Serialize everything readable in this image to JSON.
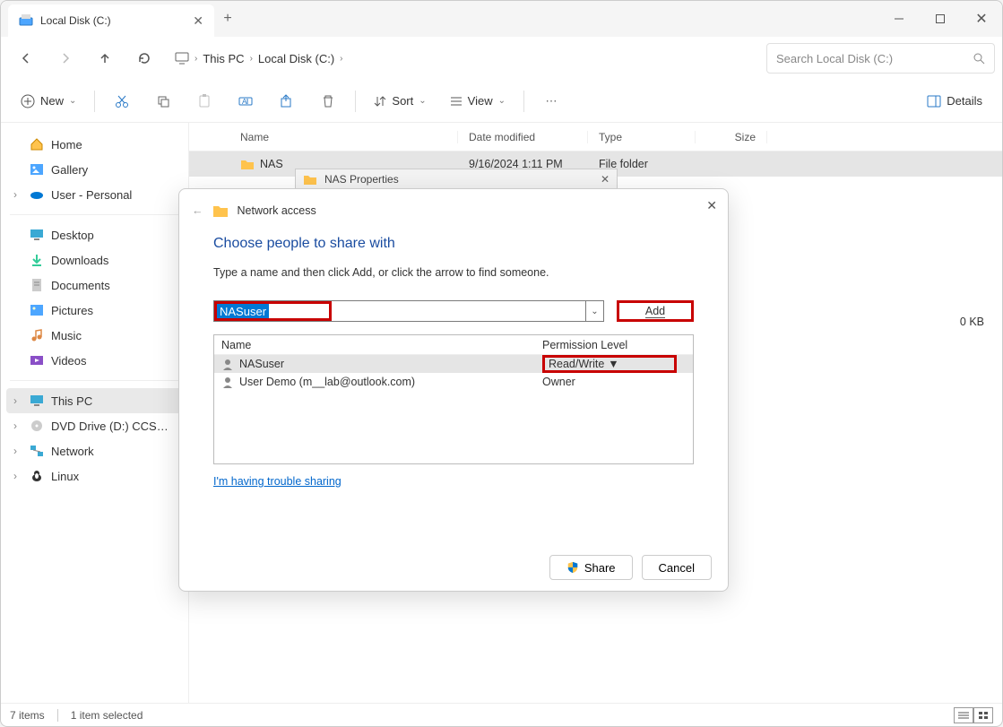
{
  "window": {
    "tab_title": "Local Disk (C:)",
    "breadcrumbs": [
      "This PC",
      "Local Disk (C:)"
    ],
    "search_placeholder": "Search Local Disk (C:)"
  },
  "toolbar": {
    "new": "New",
    "sort": "Sort",
    "view": "View",
    "details": "Details"
  },
  "sidebar": {
    "home": "Home",
    "gallery": "Gallery",
    "user_personal": "User - Personal",
    "desktop": "Desktop",
    "downloads": "Downloads",
    "documents": "Documents",
    "pictures": "Pictures",
    "music": "Music",
    "videos": "Videos",
    "this_pc": "This PC",
    "dvd": "DVD Drive (D:) CCSA_X64FR",
    "network": "Network",
    "linux": "Linux"
  },
  "columns": {
    "name": "Name",
    "date": "Date modified",
    "type": "Type",
    "size": "Size"
  },
  "files": [
    {
      "name": "NAS",
      "date": "9/16/2024 1:11 PM",
      "type": "File folder",
      "size": ""
    }
  ],
  "right_panel_size": "0 KB",
  "props_dialog": {
    "title": "NAS Properties"
  },
  "share_dialog": {
    "header": "Network access",
    "title": "Choose people to share with",
    "instruction": "Type a name and then click Add, or click the arrow to find someone.",
    "input_value": "NASuser",
    "add_button": "Add",
    "col_name": "Name",
    "col_perm": "Permission Level",
    "rows": [
      {
        "name": "NASuser",
        "perm": "Read/Write"
      },
      {
        "name": "User Demo (m__lab@outlook.com)",
        "perm": "Owner"
      }
    ],
    "trouble_link": "I'm having trouble sharing",
    "share_button": "Share",
    "cancel_button": "Cancel"
  },
  "statusbar": {
    "items": "7 items",
    "selected": "1 item selected"
  }
}
